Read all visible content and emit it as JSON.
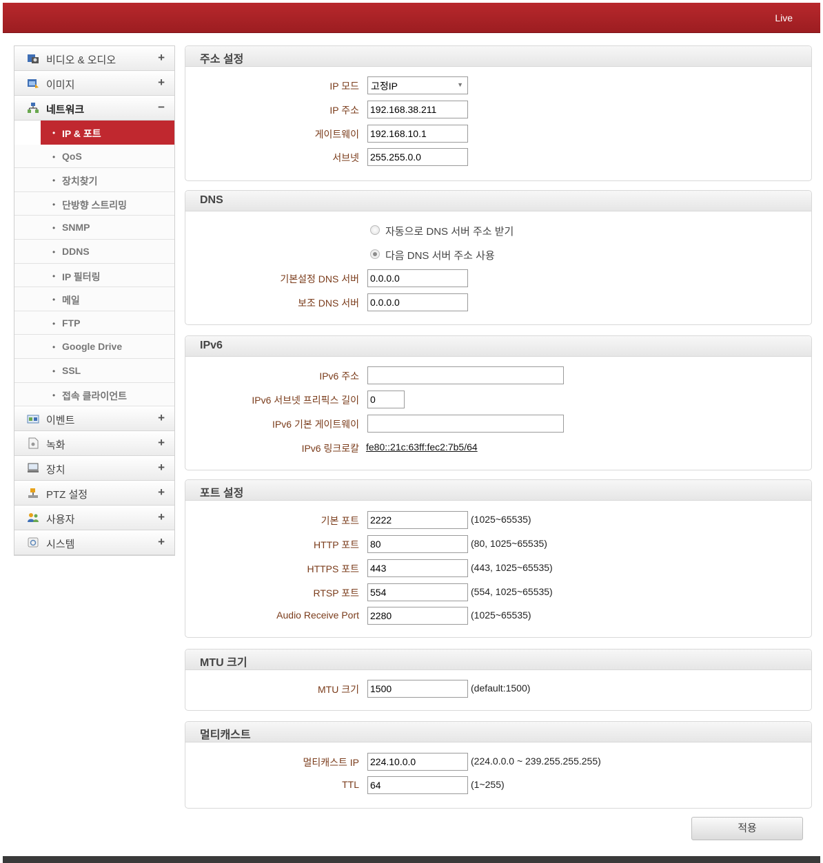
{
  "topbar": {
    "live_label": "Live"
  },
  "sidebar": {
    "items": [
      {
        "label": "비디오 & 오디오",
        "sign": "+",
        "icon": "video-audio-icon"
      },
      {
        "label": "이미지",
        "sign": "+",
        "icon": "image-icon"
      },
      {
        "label": "네트워크",
        "sign": "−",
        "icon": "network-icon"
      },
      {
        "label": "이벤트",
        "sign": "+",
        "icon": "event-icon"
      },
      {
        "label": "녹화",
        "sign": "+",
        "icon": "record-icon"
      },
      {
        "label": "장치",
        "sign": "+",
        "icon": "device-icon"
      },
      {
        "label": "PTZ 설정",
        "sign": "+",
        "icon": "ptz-icon"
      },
      {
        "label": "사용자",
        "sign": "+",
        "icon": "user-icon"
      },
      {
        "label": "시스템",
        "sign": "+",
        "icon": "system-icon"
      }
    ],
    "network_sub": [
      "IP & 포트",
      "QoS",
      "장치찾기",
      "단방향 스트리밍",
      "SNMP",
      "DDNS",
      "IP 필터링",
      "메일",
      "FTP",
      "Google Drive",
      "SSL",
      "접속 클라이언트"
    ],
    "bullet": "•"
  },
  "address": {
    "title": "주소 설정",
    "ip_mode_label": "IP 모드",
    "ip_mode_value": "고정IP",
    "ip_label": "IP 주소",
    "ip_value": "192.168.38.211",
    "gateway_label": "게이트웨이",
    "gateway_value": "192.168.10.1",
    "subnet_label": "서브넷",
    "subnet_value": "255.255.0.0"
  },
  "dns": {
    "title": "DNS",
    "auto_label": "자동으로 DNS 서버 주소 받기",
    "manual_label": "다음 DNS 서버 주소 사용",
    "primary_label": "기본설정 DNS 서버",
    "primary_value": "0.0.0.0",
    "secondary_label": "보조 DNS 서버",
    "secondary_value": "0.0.0.0"
  },
  "ipv6": {
    "title": "IPv6",
    "addr_label": "IPv6 주소",
    "addr_value": "",
    "prefix_label": "IPv6 서브넷 프리픽스 길이",
    "prefix_value": "0",
    "gateway_label": "IPv6 기본 게이트웨이",
    "gateway_value": "",
    "linklocal_label": "IPv6 링크로칼",
    "linklocal_value": "fe80::21c:63ff:fec2:7b5/64"
  },
  "ports": {
    "title": "포트 설정",
    "rows": [
      {
        "label": "기본 포트",
        "value": "2222",
        "hint": "(1025~65535)"
      },
      {
        "label": "HTTP 포트",
        "value": "80",
        "hint": "(80, 1025~65535)"
      },
      {
        "label": "HTTPS 포트",
        "value": "443",
        "hint": "(443, 1025~65535)"
      },
      {
        "label": "RTSP 포트",
        "value": "554",
        "hint": "(554, 1025~65535)"
      },
      {
        "label": "Audio Receive Port",
        "value": "2280",
        "hint": "(1025~65535)"
      }
    ]
  },
  "mtu": {
    "title": "MTU 크기",
    "label": "MTU 크기",
    "value": "1500",
    "hint": "(default:1500)"
  },
  "multicast": {
    "title": "멀티캐스트",
    "ip_label": "멀티캐스트 IP",
    "ip_value": "224.10.0.0",
    "ip_hint": "(224.0.0.0 ~ 239.255.255.255)",
    "ttl_label": "TTL",
    "ttl_value": "64",
    "ttl_hint": "(1~255)"
  },
  "apply_label": "적용",
  "colors": {
    "brand": "#b8282c",
    "active_menu": "#c0282f",
    "label_text": "#7a3b1a"
  }
}
